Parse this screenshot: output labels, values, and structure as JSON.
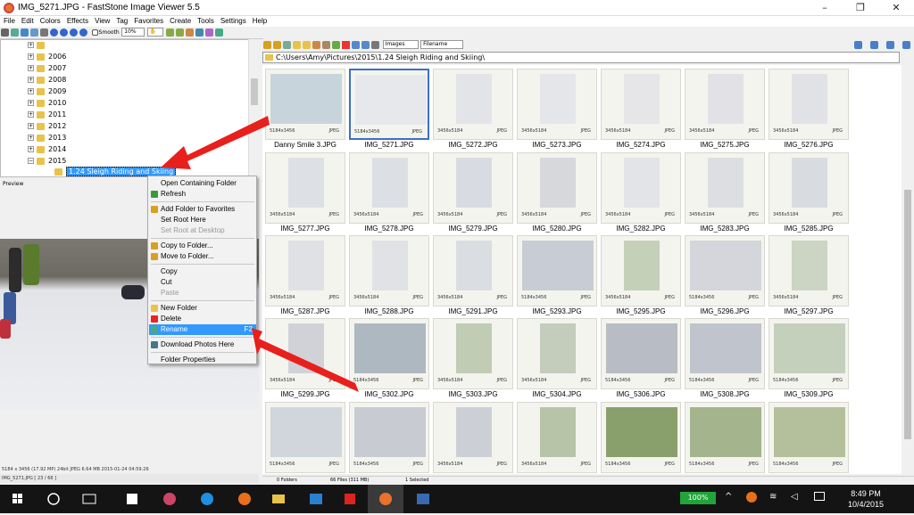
{
  "window": {
    "title": "IMG_5271.JPG  -  FastStone Image Viewer 5.5",
    "min": "–",
    "max": "❐",
    "close": "✕"
  },
  "menu": [
    "File",
    "Edit",
    "Colors",
    "Effects",
    "View",
    "Tag",
    "Favorites",
    "Create",
    "Tools",
    "Settings",
    "Help"
  ],
  "toolbar": {
    "smooth_label": "Smooth",
    "zoom_value": "10%",
    "filter_value": "Images",
    "sort_value": "Filename"
  },
  "tree": {
    "items": [
      {
        "label": ""
      },
      {
        "label": "2006"
      },
      {
        "label": "2007"
      },
      {
        "label": "2008"
      },
      {
        "label": "2009"
      },
      {
        "label": "2010"
      },
      {
        "label": "2011"
      },
      {
        "label": "2012"
      },
      {
        "label": "2013"
      },
      {
        "label": "2014"
      },
      {
        "label": "2015"
      }
    ],
    "selected_label": "1.24 Sleigh Riding and Skiing"
  },
  "preview_label": "Preview",
  "address": "C:\\Users\\Amy\\Pictures\\2015\\1.24 Sleigh Riding and Skiing\\",
  "context_menu": [
    {
      "label": "Open Containing Folder",
      "icon": "",
      "state": "normal"
    },
    {
      "label": "Refresh",
      "icon": "refresh-icon",
      "state": "normal"
    },
    {
      "sep": true
    },
    {
      "label": "Add Folder to Favorites",
      "icon": "favorites-add-icon",
      "state": "normal"
    },
    {
      "label": "Set Root Here",
      "icon": "",
      "state": "normal"
    },
    {
      "label": "Set Root at Desktop",
      "icon": "",
      "state": "disabled"
    },
    {
      "sep": true
    },
    {
      "label": "Copy to Folder...",
      "icon": "copy-folder-icon",
      "state": "normal"
    },
    {
      "label": "Move to Folder...",
      "icon": "move-folder-icon",
      "state": "normal"
    },
    {
      "sep": true
    },
    {
      "label": "Copy",
      "icon": "",
      "state": "normal"
    },
    {
      "label": "Cut",
      "icon": "",
      "state": "normal"
    },
    {
      "label": "Paste",
      "icon": "",
      "state": "disabled"
    },
    {
      "sep": true
    },
    {
      "label": "New Folder",
      "icon": "new-folder-icon",
      "state": "normal"
    },
    {
      "label": "Delete",
      "icon": "delete-icon",
      "state": "normal"
    },
    {
      "label": "Rename",
      "icon": "rename-icon",
      "state": "highlight",
      "shortcut": "F2"
    },
    {
      "sep": true
    },
    {
      "label": "Download Photos Here",
      "icon": "download-icon",
      "state": "normal"
    },
    {
      "sep": true
    },
    {
      "label": "Folder Properties",
      "icon": "",
      "state": "normal"
    }
  ],
  "thumbnails": [
    {
      "name": "Danny Smile 3.JPG",
      "res": "5184x3456",
      "fmt": "JPEG",
      "tone": "#c8d4dc"
    },
    {
      "name": "IMG_5271.JPG",
      "res": "5184x3456",
      "fmt": "JPEG",
      "tone": "#e6e8ec",
      "selected": true
    },
    {
      "name": "IMG_5272.JPG",
      "res": "3456x5184",
      "fmt": "JPEG",
      "tone": "#e2e4e8"
    },
    {
      "name": "IMG_5273.JPG",
      "res": "3456x5184",
      "fmt": "JPEG",
      "tone": "#e4e6ea"
    },
    {
      "name": "IMG_5274.JPG",
      "res": "3456x5184",
      "fmt": "JPEG",
      "tone": "#e6e6e8"
    },
    {
      "name": "IMG_5275.JPG",
      "res": "3456x5184",
      "fmt": "JPEG",
      "tone": "#e2e2e6"
    },
    {
      "name": "IMG_5276.JPG",
      "res": "3456x5184",
      "fmt": "JPEG",
      "tone": "#e0e2e6"
    },
    {
      "name": "IMG_5277.JPG",
      "res": "3456x5184",
      "fmt": "JPEG",
      "tone": "#dde0e4"
    },
    {
      "name": "IMG_5278.JPG",
      "res": "3456x5184",
      "fmt": "JPEG",
      "tone": "#dcdfe4"
    },
    {
      "name": "IMG_5279.JPG",
      "res": "3456x5184",
      "fmt": "JPEG",
      "tone": "#d8dce2"
    },
    {
      "name": "IMG_5280.JPG",
      "res": "3456x5184",
      "fmt": "JPEG",
      "tone": "#d6d8dc"
    },
    {
      "name": "IMG_5282.JPG",
      "res": "3456x5184",
      "fmt": "JPEG",
      "tone": "#e2e4e8"
    },
    {
      "name": "IMG_5283.JPG",
      "res": "3456x5184",
      "fmt": "JPEG",
      "tone": "#dcdee2"
    },
    {
      "name": "IMG_5285.JPG",
      "res": "3456x5184",
      "fmt": "JPEG",
      "tone": "#d8dce0"
    },
    {
      "name": "IMG_5287.JPG",
      "res": "3456x5184",
      "fmt": "JPEG",
      "tone": "#dfe1e5"
    },
    {
      "name": "IMG_5288.JPG",
      "res": "3456x5184",
      "fmt": "JPEG",
      "tone": "#e0e2e6"
    },
    {
      "name": "IMG_5291.JPG",
      "res": "3456x5184",
      "fmt": "JPEG",
      "tone": "#dadde2"
    },
    {
      "name": "IMG_5293.JPG",
      "res": "5184x3456",
      "fmt": "JPEG",
      "tone": "#c8ccd4"
    },
    {
      "name": "IMG_5295.JPG",
      "res": "3456x5184",
      "fmt": "JPEG",
      "tone": "#c4d0b8"
    },
    {
      "name": "IMG_5296.JPG",
      "res": "5184x3456",
      "fmt": "JPEG",
      "tone": "#d4d6dc"
    },
    {
      "name": "IMG_5297.JPG",
      "res": "3456x5184",
      "fmt": "JPEG",
      "tone": "#ccd4c4"
    },
    {
      "name": "IMG_5299.JPG",
      "res": "3456x5184",
      "fmt": "JPEG",
      "tone": "#d0d2d8"
    },
    {
      "name": "IMG_5302.JPG",
      "res": "5184x3456",
      "fmt": "JPEG",
      "tone": "#aeb8c0"
    },
    {
      "name": "IMG_5303.JPG",
      "res": "3456x5184",
      "fmt": "JPEG",
      "tone": "#c0ccb4"
    },
    {
      "name": "IMG_5304.JPG",
      "res": "3456x5184",
      "fmt": "JPEG",
      "tone": "#c4ccbc"
    },
    {
      "name": "IMG_5306.JPG",
      "res": "5184x3456",
      "fmt": "JPEG",
      "tone": "#b8bcc4"
    },
    {
      "name": "IMG_5308.JPG",
      "res": "5184x3456",
      "fmt": "JPEG",
      "tone": "#c0c4cc"
    },
    {
      "name": "IMG_5309.JPG",
      "res": "5184x3456",
      "fmt": "JPEG",
      "tone": "#c4d0bc"
    },
    {
      "name": "",
      "res": "5184x3456",
      "fmt": "JPEG",
      "tone": "#d0d6dc"
    },
    {
      "name": "",
      "res": "5184x3456",
      "fmt": "JPEG",
      "tone": "#c8ccd2"
    },
    {
      "name": "",
      "res": "3456x5184",
      "fmt": "JPEG",
      "tone": "#ccd0d6"
    },
    {
      "name": "",
      "res": "3456x5184",
      "fmt": "JPEG",
      "tone": "#b8c4a8"
    },
    {
      "name": "",
      "res": "5184x3456",
      "fmt": "JPEG",
      "tone": "#8aa06c"
    },
    {
      "name": "",
      "res": "5184x3456",
      "fmt": "JPEG",
      "tone": "#a4b48c"
    },
    {
      "name": "",
      "res": "5184x3456",
      "fmt": "JPEG",
      "tone": "#b4c09c"
    }
  ],
  "status_left": {
    "line1": "5184 x 3456 (17.92 MP)  24bit  JPEG  6.64 MB  2015-01-24 04:59:26",
    "line2": "IMG_5271.JPG [ 23 / 66 ]"
  },
  "status_right": {
    "folders": "0 Folders",
    "files": "66 Files (311 MB)",
    "selected": "1 Selected"
  },
  "taskbar": {
    "battery": "100%",
    "time": "8:49 PM",
    "date": "10/4/2015"
  },
  "colors": {
    "accent": "#3399ff",
    "arrow": "#e8201c",
    "selection": "#3c6fc8"
  }
}
